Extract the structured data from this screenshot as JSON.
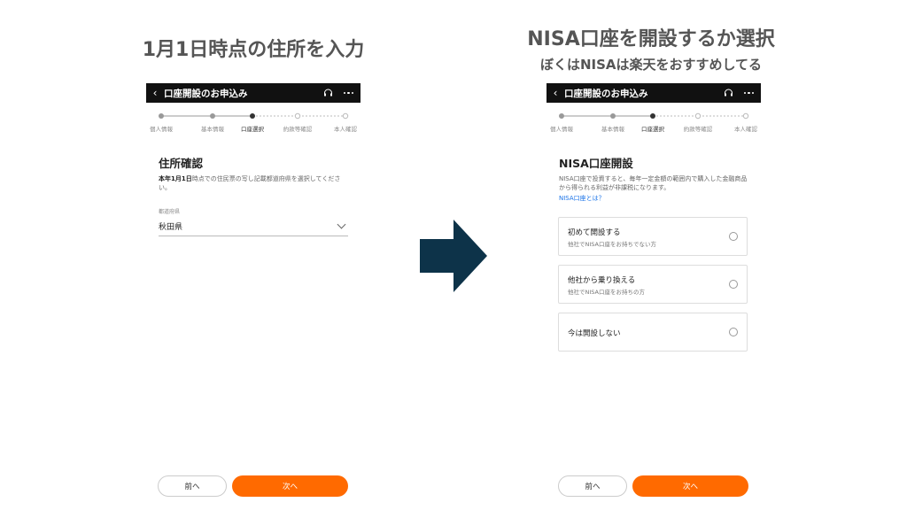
{
  "headings": {
    "left": "1月1日時点の住所を入力",
    "right_line1": "NISA口座を開設するか選択",
    "right_line2": "ぼくはNISAは楽天をおすすめしてる"
  },
  "appbar": {
    "back_glyph": "‹",
    "title": "口座開設のお申込み"
  },
  "steps": [
    "個人情報",
    "基本情報",
    "口座選択",
    "約款等確認",
    "本人確認"
  ],
  "active_step_index": 2,
  "left_screen": {
    "section_title": "住所確認",
    "desc_bold": "本年1月1日",
    "desc_rest": "時点での住民票の写し記載都道府県を選択してください。",
    "field_label": "都道府県",
    "field_value": "秋田県"
  },
  "right_screen": {
    "section_title": "NISA口座開設",
    "desc": "NISA口座で投資すると、毎年一定金額の範囲内で購入した金融商品から得られる利益が非課税になります。",
    "link": "NISA口座とは？",
    "options": [
      {
        "title": "初めて開設する",
        "sub": "他社でNISA口座をお持ちでない方"
      },
      {
        "title": "他社から乗り換える",
        "sub": "他社でNISA口座をお持ちの方"
      },
      {
        "title": "今は開設しない",
        "sub": ""
      }
    ]
  },
  "buttons": {
    "prev": "前へ",
    "next": "次へ"
  },
  "colors": {
    "accent": "#ff6a00",
    "appbar": "#111111",
    "arrow": "#0d3349",
    "link": "#1a73e8"
  }
}
